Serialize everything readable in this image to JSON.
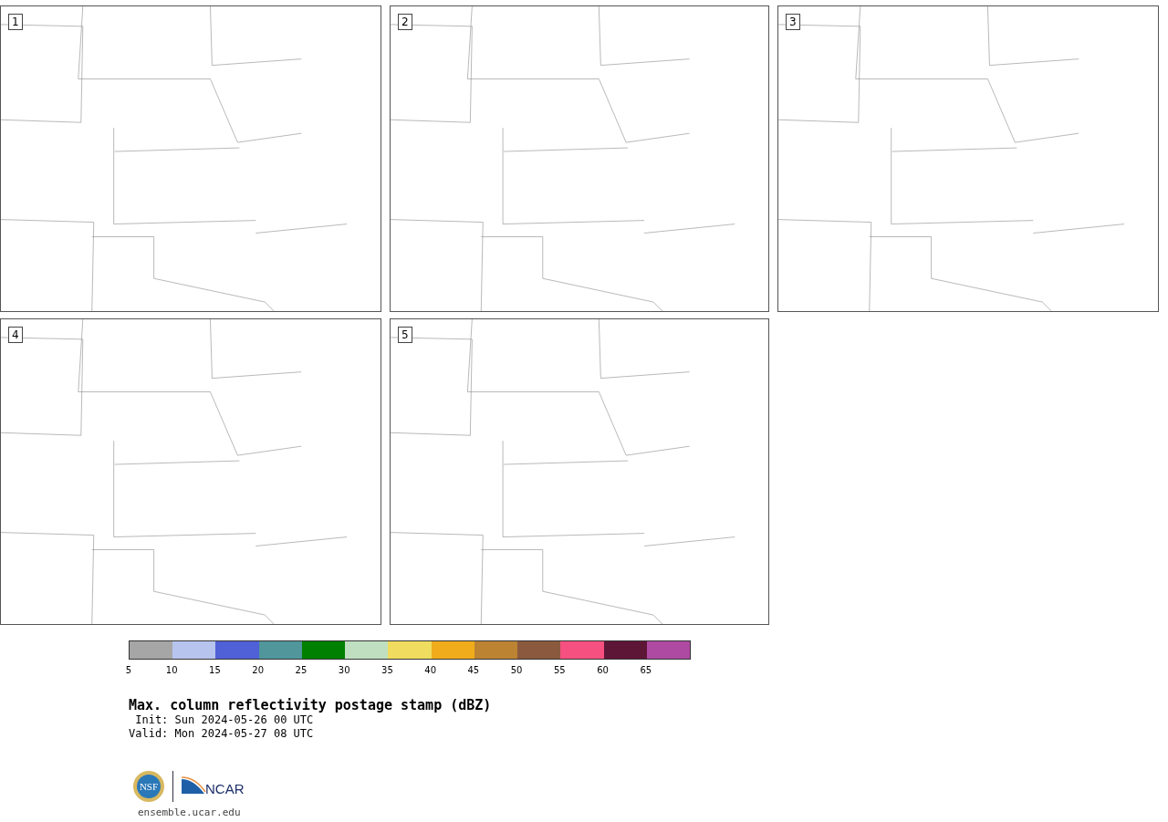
{
  "panels": [
    {
      "label": "1"
    },
    {
      "label": "2"
    },
    {
      "label": "3"
    },
    {
      "label": "4"
    },
    {
      "label": "5"
    }
  ],
  "colorbar": {
    "bins": [
      {
        "label": "5",
        "color": "#a6a6a6"
      },
      {
        "label": "10",
        "color": "#b7c4ee"
      },
      {
        "label": "15",
        "color": "#5060d6"
      },
      {
        "label": "20",
        "color": "#50969b"
      },
      {
        "label": "25",
        "color": "#008000"
      },
      {
        "label": "30",
        "color": "#c0dfc0"
      },
      {
        "label": "35",
        "color": "#f0dc5e"
      },
      {
        "label": "40",
        "color": "#f0ac1a"
      },
      {
        "label": "45",
        "color": "#bb8332"
      },
      {
        "label": "50",
        "color": "#8b5a3e"
      },
      {
        "label": "55",
        "color": "#f55080"
      },
      {
        "label": "60",
        "color": "#5e1636"
      },
      {
        "label": "65",
        "color": "#ae4aa2"
      }
    ]
  },
  "title": "Max. column reflectivity postage stamp (dBZ)",
  "init": "Init: Sun 2024-05-26 00 UTC",
  "valid": "Valid: Mon 2024-05-27 08 UTC",
  "logos": {
    "nsf": "NSF",
    "ncar": "NCAR"
  },
  "url": "ensemble.ucar.edu"
}
